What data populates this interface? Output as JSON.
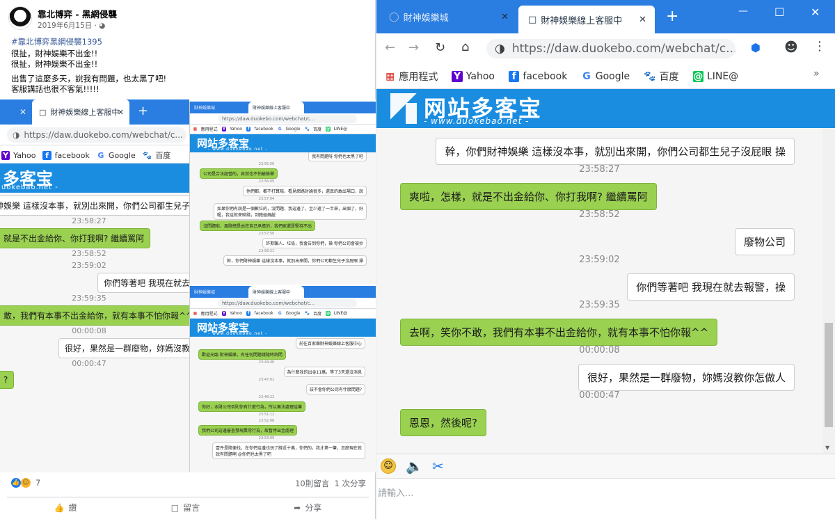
{
  "post": {
    "page_name": "靠北博弈 - 黑網侵襲",
    "date": "2019年6月15日 · ",
    "hashtag": "#靠北博弈黑網侵襲1395",
    "lines": [
      "很扯，財神娛樂不出金!!",
      "很扯，財神娛樂不出金!!",
      "出售了這麼多天，說我有問題，也太黑了吧!",
      "客服講話也很不客氣!!!!!"
    ],
    "reactions": "7",
    "comments_shares": "10則留言  1 次分享",
    "actions": [
      "讚",
      "留言",
      "分享"
    ]
  },
  "browser": {
    "tab_inactive": "財神娛樂城",
    "tab_active": "財神娛樂線上客服中",
    "new_tab": "+",
    "url": "https://daw.duokebo.com/webchat/c...",
    "url_short": "https://daw.duokebo.com/webchat/c...",
    "bookmarks": [
      "應用程式",
      "Yahoo",
      "facebook",
      "Google",
      "百度",
      "LINE@"
    ],
    "window_controls": [
      "—",
      "☐",
      "✕"
    ],
    "overflow": "»"
  },
  "site": {
    "logo": "网站多客宝",
    "sub": "- www.duokebao.net -",
    "input_placeholder": "請輸入..."
  },
  "chat": [
    {
      "type": "out",
      "text": "幹，你們財神娛樂 這樣沒本事，就別出來開，你們公司都生兒子沒屁眼 操"
    },
    {
      "type": "ts",
      "text": "23:58:27"
    },
    {
      "type": "in",
      "text": "爽啦，怎樣，就是不出金給你、你打我啊? 繼續罵阿"
    },
    {
      "type": "ts",
      "text": "23:58:52"
    },
    {
      "type": "out",
      "text": "廢物公司"
    },
    {
      "type": "ts",
      "text": "23:59:02"
    },
    {
      "type": "out",
      "text": "你們等著吧 我現在就去報警，操"
    },
    {
      "type": "ts",
      "text": "23:59:35"
    },
    {
      "type": "in",
      "text": "去啊，笑你不敢，我們有本事不出金給你，就有本事不怕你報^^"
    },
    {
      "type": "ts",
      "text": "00:00:08"
    },
    {
      "type": "out",
      "text": "很好，果然是一群廢物，妳媽沒教你怎做人"
    },
    {
      "type": "ts",
      "text": "00:00:47"
    },
    {
      "type": "in",
      "text": "恩恩，然後呢?"
    }
  ],
  "left_crop": {
    "bookmarks": [
      "Yahoo",
      "facebook",
      "Google",
      "百度"
    ],
    "logo": "多客宝",
    "sub": "uokebao.net -",
    "msgs": [
      {
        "type": "out",
        "text": "神娛樂 這樣沒本事，就別出來開，你們公司都生兒子"
      },
      {
        "type": "ts",
        "text": "23:58:27"
      },
      {
        "type": "in",
        "text": "就是不出金給你、你打我啊? 繼續罵阿"
      },
      {
        "type": "ts",
        "text": "23:58:52"
      },
      {
        "type": "ts",
        "text": "23:59:02"
      },
      {
        "type": "out",
        "text": "你們等著吧 我現在就去"
      },
      {
        "type": "ts",
        "text": "23:59:35"
      },
      {
        "type": "in",
        "text": "敢，我們有本事不出金給你，就有本事不怕你報^^"
      },
      {
        "type": "ts",
        "text": "00:00:08"
      },
      {
        "type": "out",
        "text": "很好，果然是一群廢物，妳媽沒教"
      },
      {
        "type": "ts",
        "text": "00:00:47"
      },
      {
        "type": "in",
        "text": "?"
      }
    ]
  },
  "mini1": {
    "msgs": [
      {
        "type": "out",
        "text": "我有問題呀 你們也太黑了吧"
      },
      {
        "type": "ts",
        "text": "23:55:50"
      },
      {
        "type": "in",
        "text": "公司是合法經營的，自然也不怕被檢舉"
      },
      {
        "type": "ts",
        "text": "23:56:09"
      },
      {
        "type": "out",
        "text": "他們都，都不打算賠，看見網路討論很多，還真的敢出場口，說"
      },
      {
        "type": "ts",
        "text": "23:57:04"
      },
      {
        "type": "out",
        "text": "如果你們有說是一個數位的，沒問題，我這邊了，至少進了一半來，出個了，好喔，我這就來賠錢，到時候再說"
      },
      {
        "type": "ts",
        "text": "23:57:43"
      },
      {
        "type": "in",
        "text": "沒問題啦，風險總是由您自己承擔的，我們家還是堅持不出"
      },
      {
        "type": "ts",
        "text": "23:57:58"
      },
      {
        "type": "out",
        "text": "詐欺騙人、垃圾，我會告到你們，操 你們公司會被抄"
      },
      {
        "type": "ts",
        "text": "23:58:21"
      },
      {
        "type": "out",
        "text": "幹，你們財神娛樂 這樣沒本事，就別出來開，你們公司都生兒子沒屁眼 操"
      }
    ]
  },
  "mini2": {
    "msgs": [
      {
        "type": "out",
        "text": "前往百家樂財神娛樂線上客服中心"
      },
      {
        "type": "in",
        "text": "歡迎光臨 財神娛樂，有任何問題請隨時詢問"
      },
      {
        "type": "ts",
        "text": "23:44:40"
      },
      {
        "type": "out",
        "text": "為什麼我的出金11萬，等了3天還沒消息"
      },
      {
        "type": "ts",
        "text": "23:47:01"
      },
      {
        "type": "out",
        "text": "該不會你們公司有什麼問題?"
      },
      {
        "type": "ts",
        "text": "23:48:22"
      },
      {
        "type": "in",
        "text": "你好，本財公司否則你有什麼行為，所以無法處理這筆"
      },
      {
        "type": "ts",
        "text": "23:51:12"
      },
      {
        "type": "ts",
        "text": "23:52:08"
      },
      {
        "type": "in",
        "text": "我們公司這邊審查發現異常行為，故暫停出金處理"
      },
      {
        "type": "ts",
        "text": "23:53:09"
      },
      {
        "type": "out",
        "text": "壹件是隨便找，在你們這邊也玩了將近十萬，你們的，我才第一筆，怎麼現在就說有問題啊 @你們也太黑了吧"
      }
    ]
  }
}
